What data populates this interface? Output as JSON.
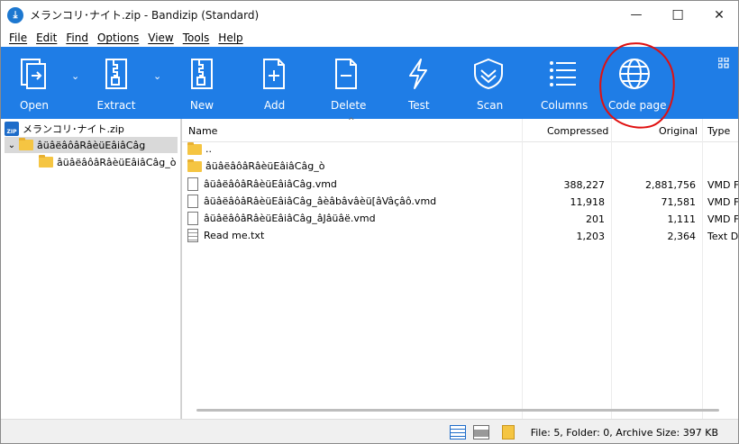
{
  "window": {
    "title": "メランコリ･ナイト.zip - Bandizip (Standard)",
    "min_glyph": "—",
    "max_glyph": "☐",
    "close_glyph": "✕"
  },
  "menu": [
    "File",
    "Edit",
    "Find",
    "Options",
    "View",
    "Tools",
    "Help"
  ],
  "toolbar": {
    "items": [
      {
        "label": "Open",
        "icon": "open-icon"
      },
      {
        "label": "Extract",
        "icon": "extract-icon"
      },
      {
        "label": "New",
        "icon": "new-archive-icon"
      },
      {
        "label": "Add",
        "icon": "add-icon"
      },
      {
        "label": "Delete",
        "icon": "delete-icon"
      },
      {
        "label": "Test",
        "icon": "test-icon"
      },
      {
        "label": "Scan",
        "icon": "scan-icon"
      },
      {
        "label": "Columns",
        "icon": "columns-icon"
      },
      {
        "label": "Code page",
        "icon": "globe-icon"
      }
    ],
    "bg_color": "#1f7de6",
    "dropdown_glyph": "⌄"
  },
  "tree": {
    "root": "メランコリ･ナイト.zip",
    "folder1": "âüâëâôâRâèüEâiâCâg",
    "folder2": "âüâëâôâRâèüEâiâCâg_ò",
    "expand_glyph": "⌄"
  },
  "columns": {
    "name": "Name",
    "compressed": "Compressed",
    "original": "Original",
    "type": "Type",
    "sort_glyph": "^"
  },
  "files": [
    {
      "name": "..",
      "compressed": "",
      "original": "",
      "type": "",
      "kind": "folder"
    },
    {
      "name": "âüâëâôâRâèüEâiâCâg_ò",
      "compressed": "",
      "original": "",
      "type": "",
      "kind": "folder"
    },
    {
      "name": "âüâëâôâRâèüEâiâCâg.vmd",
      "compressed": "388,227",
      "original": "2,881,756",
      "type": "VMD F",
      "kind": "file"
    },
    {
      "name": "âüâëâôâRâèüEâiâCâg_âèâbâvâèü[âVâçâô.vmd",
      "compressed": "11,918",
      "original": "71,581",
      "type": "VMD F",
      "kind": "file"
    },
    {
      "name": "âüâëâôâRâèüEâiâCâg_âJâüâë.vmd",
      "compressed": "201",
      "original": "1,111",
      "type": "VMD F",
      "kind": "file"
    },
    {
      "name": "Read me.txt",
      "compressed": "1,203",
      "original": "2,364",
      "type": "Text D",
      "kind": "text"
    }
  ],
  "status": {
    "text": "File: 5, Folder: 0, Archive Size: 397 KB"
  },
  "annotation_color": "#e01010"
}
